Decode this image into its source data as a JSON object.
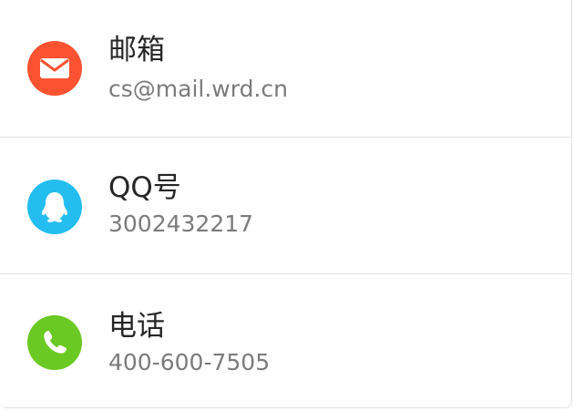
{
  "contacts": [
    {
      "label": "邮箱",
      "value": "cs@mail.wrd.cn",
      "icon": "mail-icon",
      "color": "#fb5231"
    },
    {
      "label": "QQ号",
      "value": "3002432217",
      "icon": "qq-penguin-icon",
      "color": "#23bdf0"
    },
    {
      "label": "电话",
      "value": "400-600-7505",
      "icon": "phone-icon",
      "color": "#6ac922"
    }
  ]
}
